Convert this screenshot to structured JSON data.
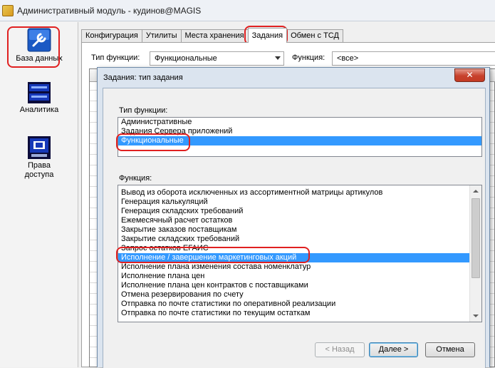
{
  "window": {
    "title": "Административный модуль - кудинов@MAGIS"
  },
  "sidebar": {
    "items": [
      {
        "label": "База данных",
        "icon": "database-wrench-icon"
      },
      {
        "label": "Аналитика",
        "icon": "analytics-icon"
      },
      {
        "label": "Права доступа",
        "icon": "access-rights-icon"
      }
    ]
  },
  "tabs": [
    "Конфигурация",
    "Утилиты",
    "Места хранения",
    "Задания",
    "Обмен с ТСД"
  ],
  "active_tab": "Задания",
  "filters": {
    "type_label": "Тип функции:",
    "type_value": "Функциональные",
    "function_label": "Функция:",
    "function_value": "<все>"
  },
  "dialog": {
    "title": "Задания: тип задания",
    "close_glyph": "✕",
    "type_group_label": "Тип функции:",
    "type_items": [
      "Административные",
      "Задания Сервера приложений",
      "Функциональные"
    ],
    "type_selected": "Функциональные",
    "function_group_label": "Функция:",
    "function_items": [
      "Вывод из оборота исключенных из ассортиментной матрицы артикулов",
      "Генерация калькуляций",
      "Генерация складских требований",
      "Ежемесячный расчет остатков",
      "Закрытие заказов поставщикам",
      "Закрытие складских требований",
      "Запрос остатков ЕГАИС",
      "Исполнение / завершение маркетинговых акций",
      "Исполнение плана изменения состава номенклатур",
      "Исполнение плана цен",
      "Исполнение плана цен контрактов с поставщиками",
      "Отмена резервирования по счету",
      "Отправка по почте статистики по оперативной реализации",
      "Отправка по почте статистики по текущим остаткам"
    ],
    "function_selected": "Исполнение / завершение маркетинговых акций",
    "buttons": {
      "back": "< Назад",
      "next": "Далее >",
      "cancel": "Отмена"
    }
  },
  "colors": {
    "selection": "#3399ff",
    "highlight_annotation": "#e02020"
  }
}
